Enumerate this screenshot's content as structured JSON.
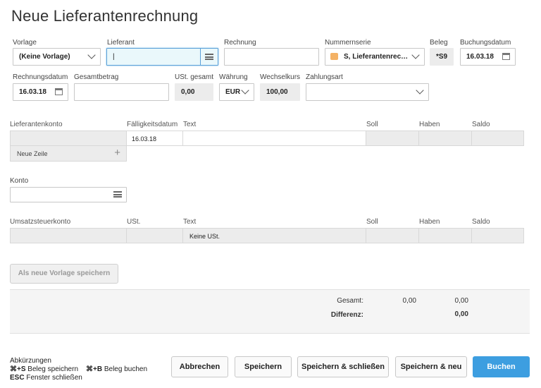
{
  "title": "Neue Lieferantenrechnung",
  "row1": {
    "vorlage_label": "Vorlage",
    "vorlage_value": "(Keine Vorlage)",
    "lieferant_label": "Lieferant",
    "lieferant_value": "|",
    "rechnung_label": "Rechnung",
    "rechnung_value": "",
    "nummernserie_label": "Nummernserie",
    "nummernserie_value": "S, Lieferantenrec…",
    "beleg_label": "Beleg",
    "beleg_value": "*S9",
    "buchungsdatum_label": "Buchungsdatum",
    "buchungsdatum_value": "16.03.18"
  },
  "row2": {
    "rechnungsdatum_label": "Rechnungsdatum",
    "rechnungsdatum_value": "16.03.18",
    "gesamtbetrag_label": "Gesamtbetrag",
    "gesamtbetrag_value": "",
    "ust_gesamt_label": "USt. gesamt",
    "ust_gesamt_value": "0,00",
    "waehrung_label": "Währung",
    "waehrung_value": "EUR",
    "wechselkurs_label": "Wechselkurs",
    "wechselkurs_value": "100,00",
    "zahlungsart_label": "Zahlungsart",
    "zahlungsart_value": ""
  },
  "grid1": {
    "headers": [
      "Lieferantenkonto",
      "Fälligkeitsdatum",
      "Text",
      "Soll",
      "Haben",
      "Saldo"
    ],
    "row": [
      "",
      "16.03.18",
      "",
      "",
      "",
      ""
    ],
    "new_row_label": "Neue Zeile"
  },
  "konto": {
    "label": "Konto",
    "value": ""
  },
  "grid2": {
    "headers": [
      "Umsatzsteuerkonto",
      "USt.",
      "Text",
      "Soll",
      "Haben",
      "Saldo"
    ],
    "row": [
      "",
      "",
      "Keine USt.",
      "",
      "",
      ""
    ]
  },
  "save_template_label": "Als neue Vorlage speichern",
  "totals": {
    "gesamt_label": "Gesamt:",
    "gesamt_soll": "0,00",
    "gesamt_haben": "0,00",
    "differenz_label": "Differenz:",
    "differenz_value": "0,00"
  },
  "shortcuts": {
    "heading": "Abkürzungen",
    "s_key": "⌘+S",
    "s_text": "Beleg speichern",
    "b_key": "⌘+B",
    "b_text": "Beleg buchen",
    "esc_key": "ESC",
    "esc_text": "Fenster schließen"
  },
  "buttons": {
    "cancel": "Abbrechen",
    "save": "Speichern",
    "save_close": "Speichern & schließen",
    "save_new": "Speichern & neu",
    "book": "Buchen"
  },
  "colors": {
    "primary": "#3d9ee0",
    "focus": "#5aa0d8",
    "grey_field": "#ececec"
  }
}
